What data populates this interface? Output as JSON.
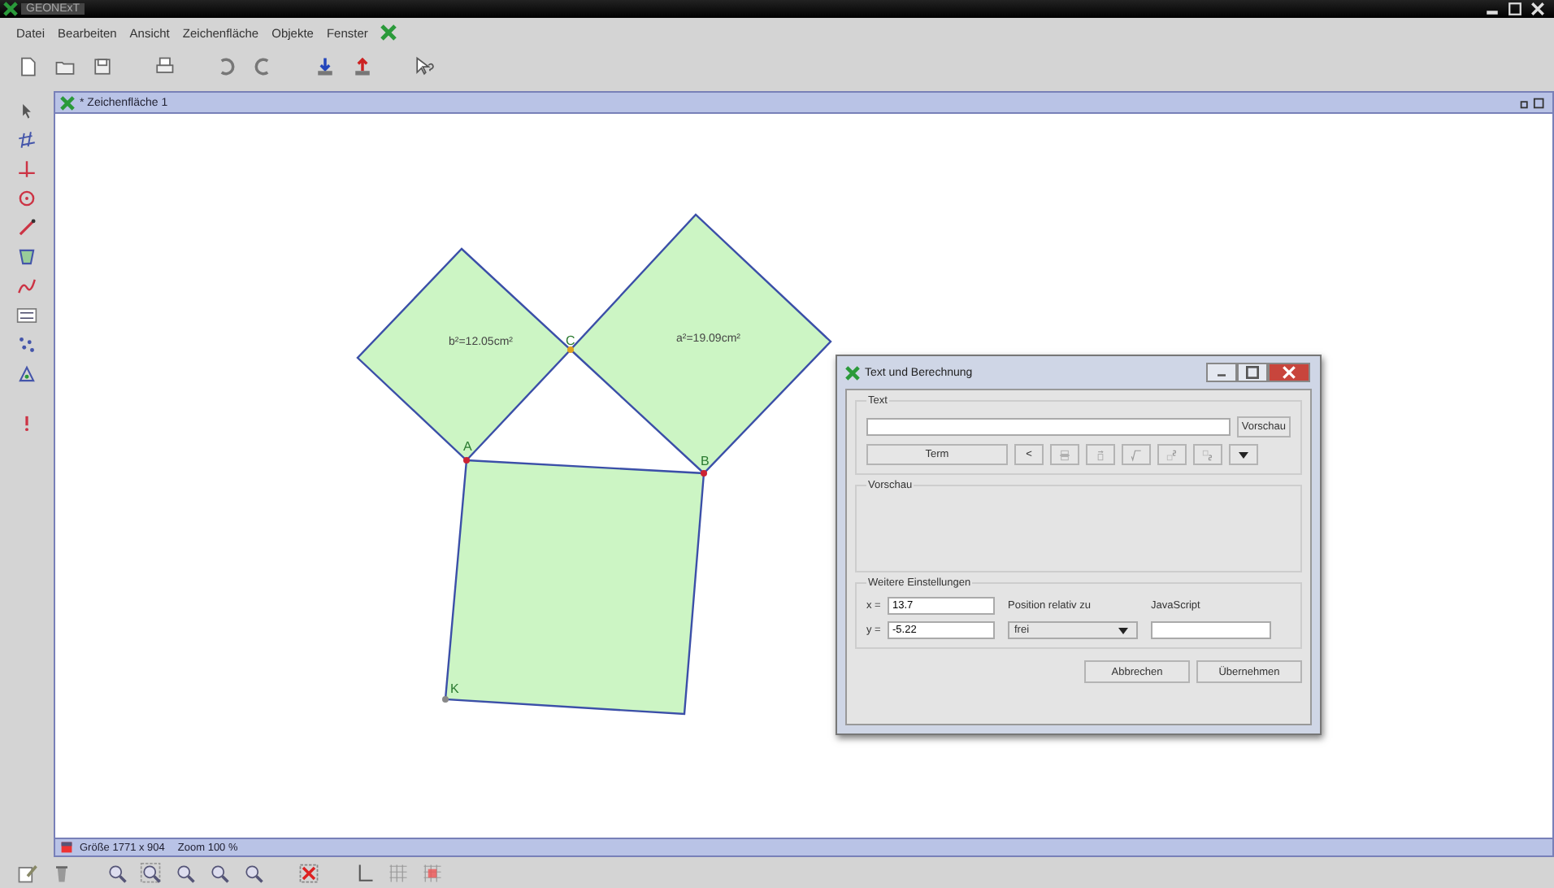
{
  "app_title": "GEONExT",
  "menu": [
    "Datei",
    "Bearbeiten",
    "Ansicht",
    "Zeichenfläche",
    "Objekte",
    "Fenster"
  ],
  "drawing_window": {
    "title": "* Zeichenfläche 1",
    "size": "Größe 1771 x 904",
    "zoom": "Zoom 100 %"
  },
  "figure": {
    "area_labels": [
      "b²=12.05cm²",
      "a²=19.09cm²"
    ],
    "points": [
      {
        "name": "A",
        "color": "#cc2233"
      },
      {
        "name": "B",
        "color": "#cc2233"
      },
      {
        "name": "C",
        "color": "#e0a020"
      },
      {
        "name": "K",
        "color": "#888888"
      }
    ]
  },
  "dialog": {
    "title": "Text und Berechnung",
    "text_group": "Text",
    "preview_button": "Vorschau",
    "term_button": "Term",
    "less_button": "<",
    "preview_group": "Vorschau",
    "settings_group": "Weitere Einstellungen",
    "x_label": "x =",
    "x_value": "13.7",
    "y_label": "y =",
    "y_value": "-5.22",
    "position_label": "Position relativ zu",
    "position_value": "frei",
    "javascript_label": "JavaScript",
    "buttons": [
      "Abbrechen",
      "Übernehmen"
    ]
  }
}
